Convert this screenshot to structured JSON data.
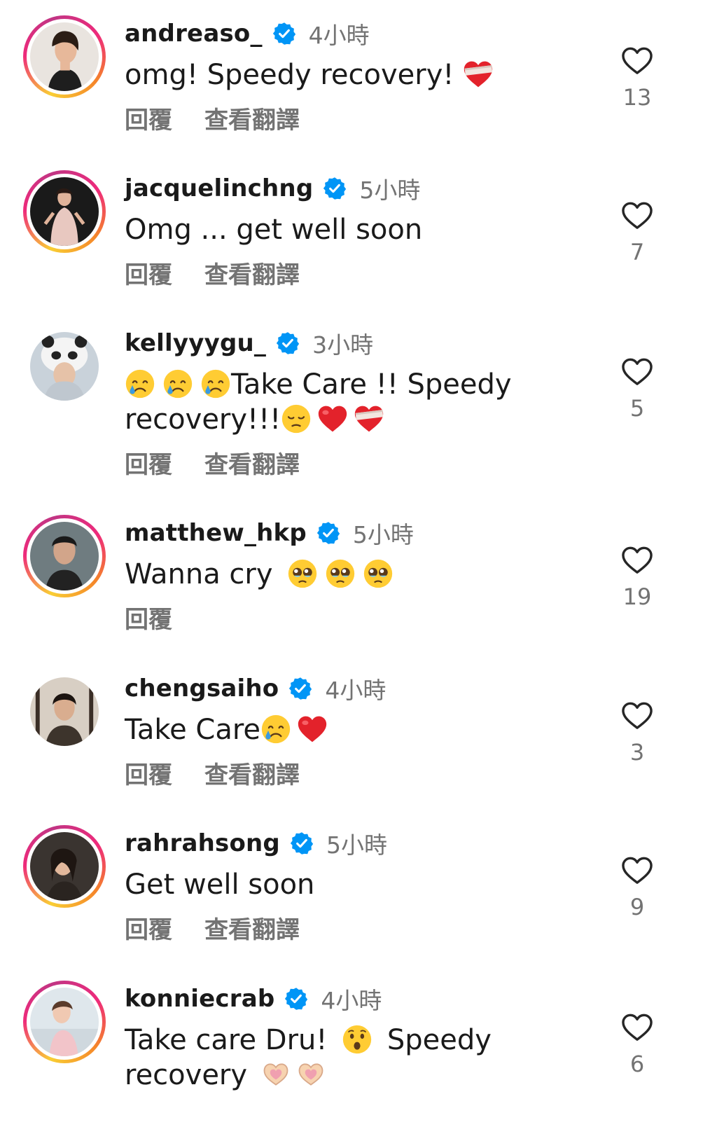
{
  "comments": [
    {
      "username": "andreaso_",
      "time": "4小時",
      "text": "omg! Speedy recovery!",
      "emoji": [
        "mending-heart"
      ],
      "reply": "回覆",
      "translate": "查看翻譯",
      "likes": "13",
      "ring": true
    },
    {
      "username": "jacquelinchng",
      "time": "5小時",
      "text": "Omg ... get well soon",
      "emoji": [],
      "reply": "回覆",
      "translate": "查看翻譯",
      "likes": "7",
      "ring": true
    },
    {
      "username": "kellyyygu_",
      "time": "3小時",
      "text_line1": "Take Care !! Speedy",
      "text_line2": "recovery!!!",
      "emoji_lead": [
        "crying-face",
        "crying-face",
        "crying-face"
      ],
      "emoji_trail": [
        "pensive-face",
        "red-heart",
        "mending-heart"
      ],
      "reply": "回覆",
      "translate": "查看翻譯",
      "likes": "5",
      "ring": false
    },
    {
      "username": "matthew_hkp",
      "time": "5小時",
      "text": "Wanna cry",
      "emoji": [
        "pleading-face",
        "pleading-face",
        "pleading-face"
      ],
      "reply": "回覆",
      "likes": "19",
      "ring": true
    },
    {
      "username": "chengsaiho",
      "time": "4小時",
      "text": "Take Care",
      "emoji": [
        "crying-face",
        "red-heart"
      ],
      "reply": "回覆",
      "translate": "查看翻譯",
      "likes": "3",
      "ring": false
    },
    {
      "username": "rahrahsong",
      "time": "5小時",
      "text": "Get well soon",
      "emoji": [],
      "reply": "回覆",
      "translate": "查看翻譯",
      "likes": "9",
      "ring": true
    },
    {
      "username": "konniecrab",
      "time": "4小時",
      "text_line1": "Take care Dru!",
      "text_line1b": "Speedy",
      "text_line2": "recovery",
      "emoji_mid": [
        "hushed-face"
      ],
      "emoji_trail": [
        "heart-hands",
        "heart-hands"
      ],
      "likes": "6",
      "ring": true
    }
  ],
  "colors": {
    "verified": "#0095f6",
    "secondary_text": "#737373",
    "primary_text": "#1a1a1a"
  },
  "icons": {
    "verified": "verified-badge-icon",
    "like": "heart-outline-icon"
  }
}
